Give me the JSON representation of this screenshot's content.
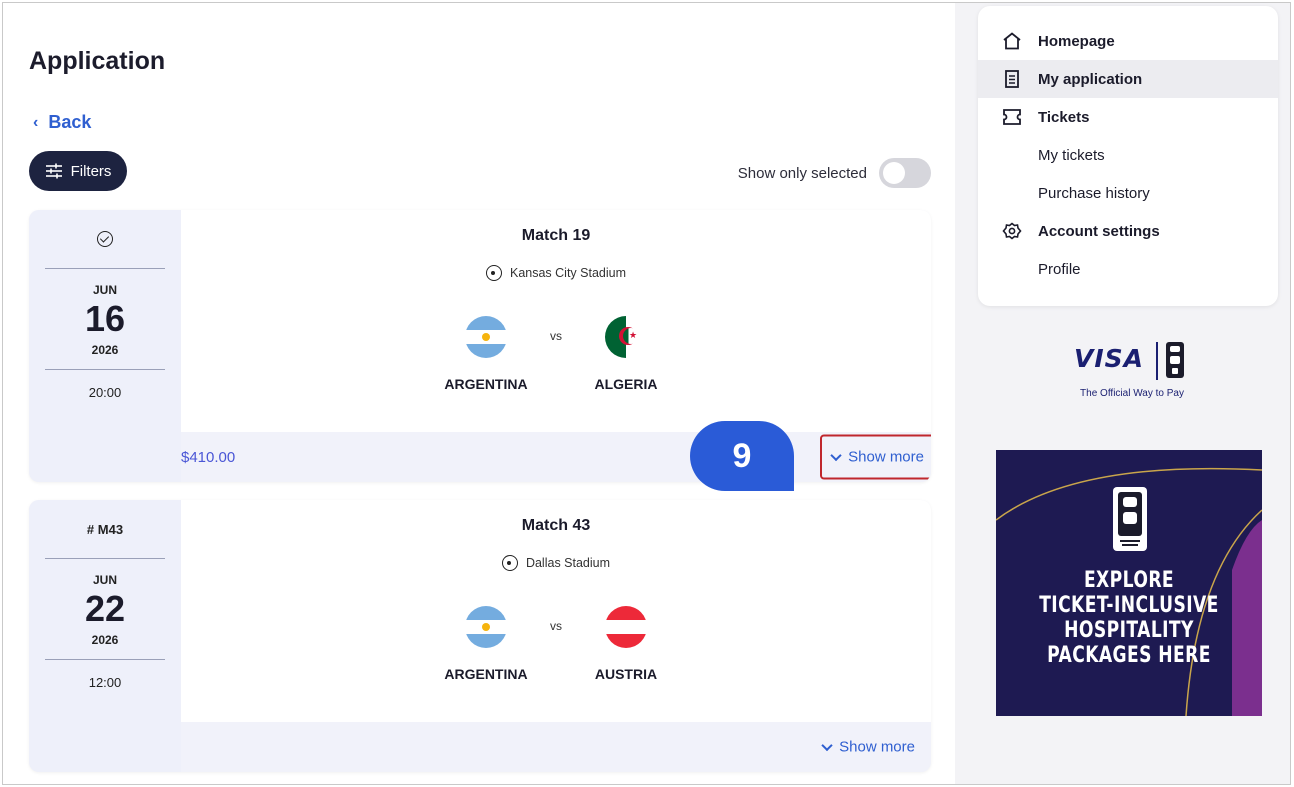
{
  "page": {
    "title": "Application",
    "back_label": "Back",
    "filters_label": "Filters",
    "show_only_selected_label": "Show only selected",
    "show_only_selected_on": false
  },
  "matches": [
    {
      "top_label": "",
      "top_icon": "check-circle-icon",
      "month": "JUN",
      "day": "16",
      "year": "2026",
      "time": "20:00",
      "title": "Match 19",
      "venue": "Kansas City Stadium",
      "home_team": "ARGENTINA",
      "away_team": "ALGERIA",
      "vs": "vs",
      "price": "$410.00",
      "show_more": "Show more"
    },
    {
      "top_label": "# M43",
      "month": "JUN",
      "day": "22",
      "year": "2026",
      "time": "12:00",
      "title": "Match 43",
      "venue": "Dallas Stadium",
      "home_team": "ARGENTINA",
      "away_team": "AUSTRIA",
      "vs": "vs",
      "price": "",
      "show_more": "Show more"
    }
  ],
  "step_badge": "9",
  "menu": {
    "items": [
      {
        "label": "Homepage",
        "icon": "home-icon",
        "type": "primary"
      },
      {
        "label": "My application",
        "icon": "document-icon",
        "type": "primary",
        "active": true
      },
      {
        "label": "Tickets",
        "icon": "ticket-icon",
        "type": "primary"
      },
      {
        "label": "My tickets",
        "type": "sub"
      },
      {
        "label": "Purchase history",
        "type": "sub"
      },
      {
        "label": "Account settings",
        "icon": "gear-icon",
        "type": "primary"
      },
      {
        "label": "Profile",
        "type": "sub"
      }
    ]
  },
  "sponsor": {
    "brand": "VISA",
    "tagline": "The Official Way to Pay"
  },
  "banner": {
    "lines": [
      "EXPLORE",
      "TICKET-INCLUSIVE",
      "HOSPITALITY",
      "PACKAGES HERE"
    ]
  },
  "colors": {
    "accent_blue": "#2f5fd0",
    "price_color": "#4a56d6",
    "filters_bg": "#1d2340",
    "banner_bg": "#1e1a52",
    "highlight_border": "#c0272d"
  }
}
